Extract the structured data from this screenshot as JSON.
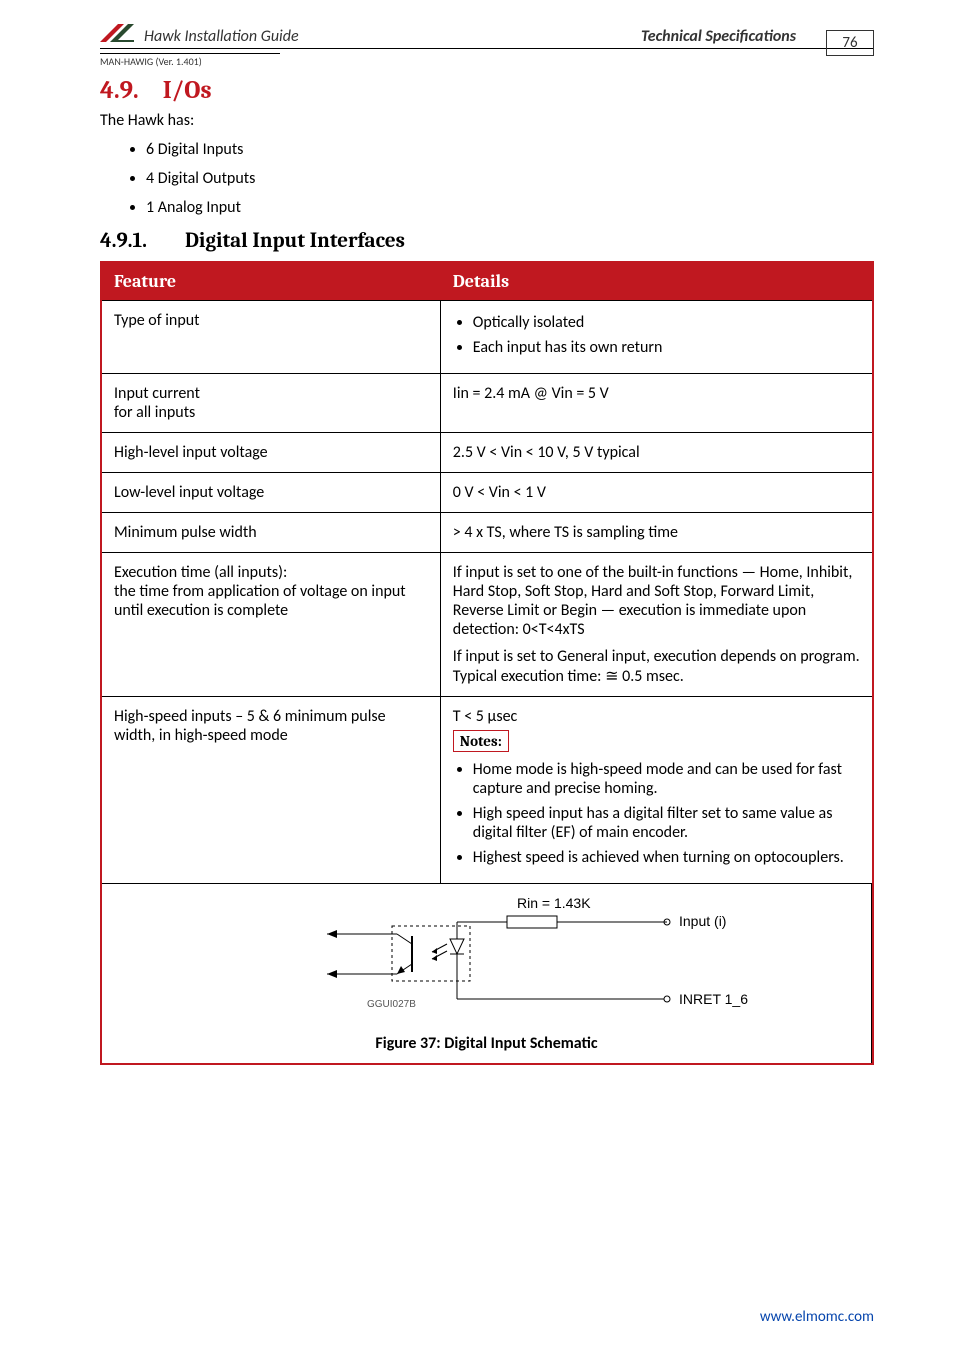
{
  "header": {
    "title": "Hawk Installation Guide",
    "spec": "Technical Specifications",
    "page_number": "76",
    "man_line": "MAN-HAWIG (Ver. 1.401)"
  },
  "section": {
    "number": "4.9.",
    "title": "I/Os",
    "intro": "The Hawk has:",
    "bullets": [
      "6 Digital Inputs",
      "4 Digital Outputs",
      "1 Analog Input"
    ]
  },
  "subsection": {
    "number": "4.9.1.",
    "title": "Digital Input Interfaces"
  },
  "table": {
    "headers": [
      "Feature",
      "Details"
    ],
    "rows": [
      {
        "feature": [
          "Type of input"
        ],
        "details_list": [
          "Optically isolated",
          "Each input has its own return"
        ]
      },
      {
        "feature": [
          "Input current",
          "for all inputs"
        ],
        "details": "Iin = 2.4 mA @ Vin = 5 V"
      },
      {
        "feature": [
          "High-level input voltage"
        ],
        "details": "2.5 V < Vin < 10 V, 5 V typical"
      },
      {
        "feature": [
          "Low-level input voltage"
        ],
        "details": "0 V < Vin < 1 V"
      },
      {
        "feature": [
          "Minimum pulse width"
        ],
        "details": "> 4 x TS, where TS is sampling time"
      },
      {
        "feature": [
          "Execution time (all inputs):",
          "the time from application of voltage on input until execution is complete"
        ],
        "details_paras": [
          "If input is set to one of the built-in functions — Home, Inhibit, Hard Stop, Soft Stop, Hard and Soft Stop, Forward Limit, Reverse Limit or Begin — execution is immediate upon detection: 0<T<4xTS",
          "If input is set to General input, execution depends on program. Typical execution time: ≅ 0.5 msec."
        ]
      },
      {
        "feature": [
          "High-speed inputs – 5 & 6 minimum pulse width, in high-speed mode"
        ],
        "details_lead": "T < 5 µsec",
        "notes_label": "Notes:",
        "details_list": [
          "Home mode is high-speed mode and can be used for fast capture and precise homing.",
          "High speed input has a digital filter set to same value as digital filter (EF) of main encoder.",
          "Highest speed is achieved when turning on optocouplers."
        ]
      }
    ],
    "schematic": {
      "rin": "Rin = 1.43K",
      "input_label": "Input (i)",
      "inret_label": "INRET 1_6",
      "gg_label": "GGUI027B",
      "caption": "Figure 37: Digital Input Schematic"
    }
  },
  "footer": {
    "url": "www.elmomc.com"
  }
}
